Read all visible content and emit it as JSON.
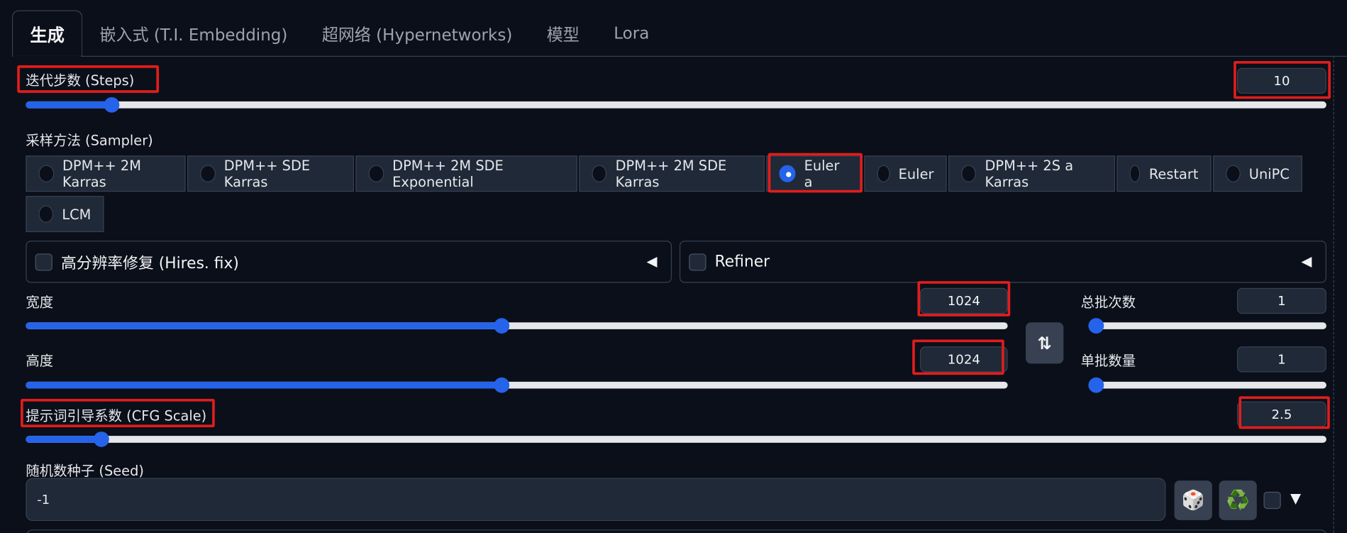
{
  "tabs": [
    {
      "label": "生成",
      "active": true
    },
    {
      "label": "嵌入式 (T.I. Embedding)",
      "active": false
    },
    {
      "label": "超网络 (Hypernetworks)",
      "active": false
    },
    {
      "label": "模型",
      "active": false
    },
    {
      "label": "Lora",
      "active": false
    }
  ],
  "steps": {
    "label": "迭代步数 (Steps)",
    "value": "10",
    "fraction": 0.066
  },
  "sampler": {
    "label": "采样方法 (Sampler)",
    "row1": [
      "DPM++ 2M Karras",
      "DPM++ SDE Karras",
      "DPM++ 2M SDE Exponential",
      "DPM++ 2M SDE Karras",
      "Euler a",
      "Euler",
      "DPM++ 2S a Karras",
      "Restart",
      "UniPC"
    ],
    "row2": [
      "LCM"
    ],
    "selected": "Euler a"
  },
  "hires": {
    "label": "高分辨率修复 (Hires. fix)",
    "arrow": "◀"
  },
  "refiner": {
    "label": "Refiner",
    "arrow": "◀"
  },
  "width": {
    "label": "宽度",
    "value": "1024",
    "fraction": 0.485
  },
  "height": {
    "label": "高度",
    "value": "1024",
    "fraction": 0.485
  },
  "swap_icon": "⇅",
  "batch_count": {
    "label": "总批次数",
    "value": "1",
    "fraction": 0.0
  },
  "batch_size": {
    "label": "单批数量",
    "value": "1",
    "fraction": 0.0
  },
  "cfg": {
    "label": "提示词引导系数 (CFG Scale)",
    "value": "2.5",
    "fraction": 0.058
  },
  "seed": {
    "label": "随机数种子 (Seed)",
    "value": "-1",
    "dice_icon": "🎲",
    "recycle_icon": "♻️",
    "extra_arrow": "▼"
  },
  "colors": {
    "accent": "#2563eb",
    "highlight": "#e11d1d",
    "background": "#0b0f19"
  }
}
